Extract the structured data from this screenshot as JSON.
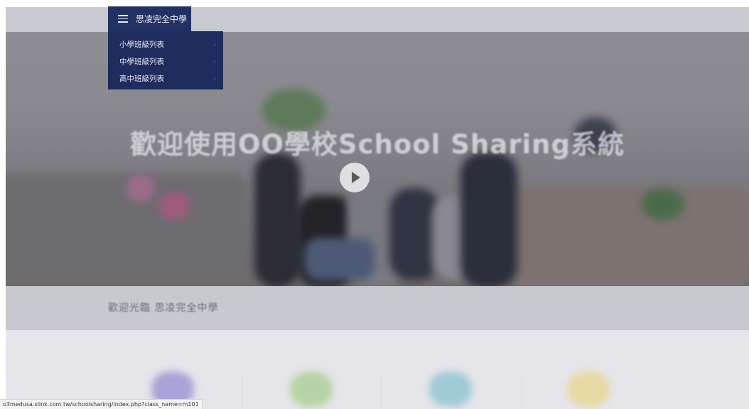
{
  "menu": {
    "title": "思凌完全中學",
    "items": [
      {
        "label": "小學班級列表"
      },
      {
        "label": "中學班級列表"
      },
      {
        "label": "高中班級列表"
      }
    ]
  },
  "hero": {
    "title": "歡迎使用OO學校School Sharing系統"
  },
  "welcome": {
    "text": "歡迎光臨 思凌完全中學"
  },
  "status_bar": {
    "url": "o3medusa.slink.com.tw/schoolsharing/index.php?class_name=m101"
  },
  "icons": {
    "menu": "hamburger-icon",
    "play": "play-icon",
    "chevron": "chevron-right-icon"
  },
  "colors": {
    "menu_bg": "#233063",
    "overlay": "#e9e8ed"
  }
}
